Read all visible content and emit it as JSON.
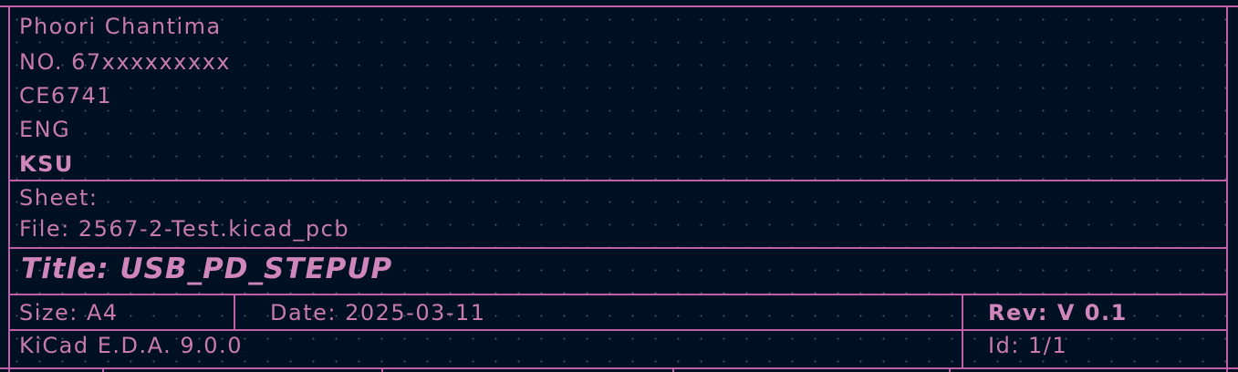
{
  "title_block": {
    "company": {
      "line1": "Phoori Chantima",
      "line2": "NO. 67xxxxxxxxx",
      "line3": "CE6741",
      "line4": "ENG",
      "line5": "KSU"
    },
    "sheet_label": "Sheet:",
    "file_label": "File: 2567-2-Test.kicad_pcb",
    "title": "Title: USB_PD_STEPUP",
    "size": "Size: A4",
    "date": "Date: 2025-03-11",
    "rev": "Rev: V 0.1",
    "generator": "KiCad E.D.A. 9.0.0",
    "id": "Id: 1/1"
  },
  "colors": {
    "background": "#001023",
    "frame": "#c05fa8",
    "text": "#c87aae",
    "grid_dot": "#828ca0"
  }
}
